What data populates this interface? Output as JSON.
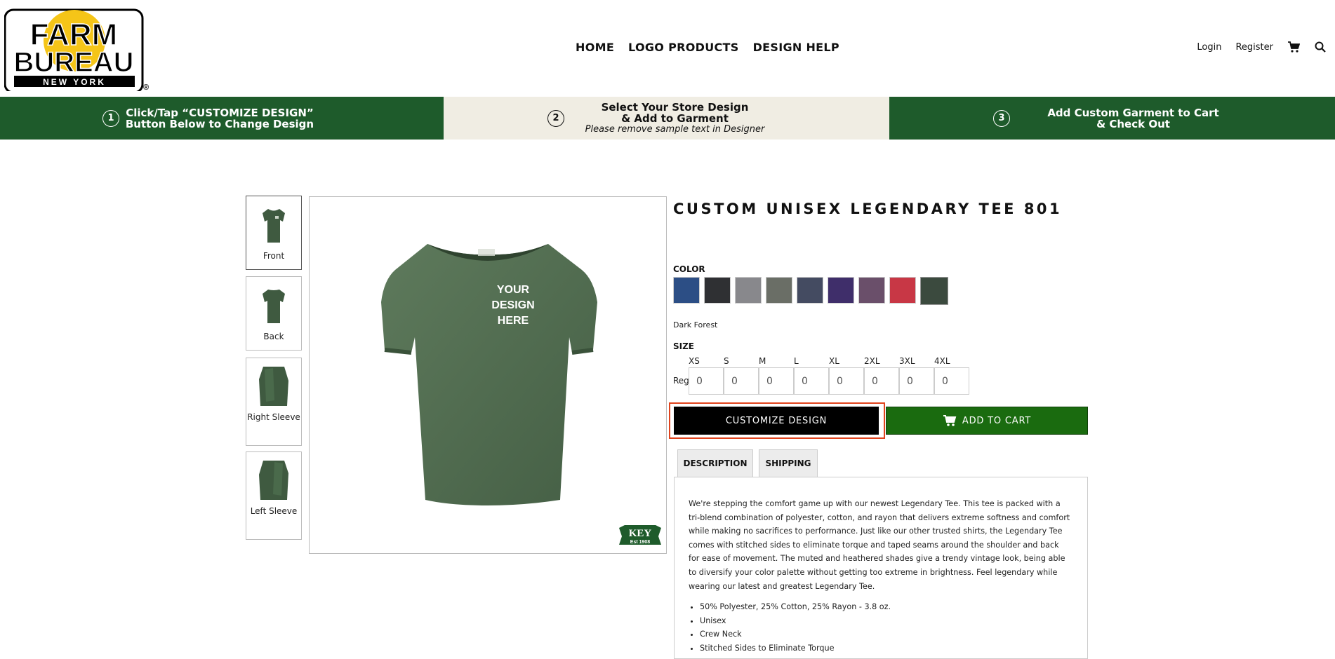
{
  "brand": {
    "logo_line1": "FARM",
    "logo_line2": "BUREAU",
    "logo_line3": "NEW YORK",
    "logo_mark": "®"
  },
  "nav": {
    "items": [
      "HOME",
      "LOGO PRODUCTS",
      "DESIGN HELP"
    ]
  },
  "utility": {
    "login": "Login",
    "register": "Register",
    "cart_icon": "cart-icon",
    "search_icon": "search-icon"
  },
  "steps": [
    {
      "num": "1",
      "line1": "Click/Tap “CUSTOMIZE DESIGN”",
      "line2": "Button Below to Change Design",
      "sub": ""
    },
    {
      "num": "2",
      "line1": "Select Your Store Design",
      "line2": "& Add to Garment",
      "sub": "Please remove sample text in Designer"
    },
    {
      "num": "3",
      "line1": "Add Custom Garment to Cart",
      "line2": "& Check Out",
      "sub": ""
    }
  ],
  "colors": {
    "step_green": "#1e5b2b",
    "step_cream": "#f0ede3",
    "customize_outline": "#e0431d",
    "cart_green": "#1a6b0f"
  },
  "thumbnails": [
    {
      "label": "Front"
    },
    {
      "label": "Back"
    },
    {
      "label": "Right Sleeve"
    },
    {
      "label": "Left Sleeve"
    }
  ],
  "main_image": {
    "design_text": [
      "YOUR",
      "DESIGN",
      "HERE"
    ],
    "key_logo": "KEY",
    "key_sub": "Est 1908"
  },
  "product": {
    "title": "CUSTOM UNISEX LEGENDARY TEE 801",
    "color_label": "COLOR",
    "swatches": [
      "#2c4e85",
      "#2f3033",
      "#88888c",
      "#6a6e66",
      "#444b61",
      "#3f2e6a",
      "#6a4f6a",
      "#c83745",
      "#3b4a3e"
    ],
    "selected_color": "Dark Forest",
    "size_label": "SIZE",
    "sizes": [
      "XS",
      "S",
      "M",
      "L",
      "XL",
      "2XL",
      "3XL",
      "4XL"
    ],
    "row_label": "Reg",
    "quantities": [
      "0",
      "0",
      "0",
      "0",
      "0",
      "0",
      "0",
      "0"
    ],
    "customize_button": "CUSTOMIZE DESIGN",
    "cart_button": "ADD TO CART"
  },
  "tabs": {
    "description": "DESCRIPTION",
    "shipping": "SHIPPING"
  },
  "description": {
    "text": "We're stepping the comfort game up with our newest Legendary Tee. This tee is packed with a tri-blend combination of polyester, cotton, and rayon that delivers extreme softness and comfort while making no sacrifices to performance. Just like our other trusted shirts, the Legendary Tee comes with stitched sides to eliminate torque and taped seams around the shoulder and back for ease of movement. The muted and heathered shades give a trendy vintage look, being able to diversify your color palette without getting too extreme in brightness. Feel legendary while wearing our latest and greatest Legendary Tee.",
    "bullets": [
      "50% Polyester, 25% Cotton, 25% Rayon - 3.8 oz.",
      "Unisex",
      "Crew Neck",
      "Stitched Sides to Eliminate Torque"
    ]
  }
}
